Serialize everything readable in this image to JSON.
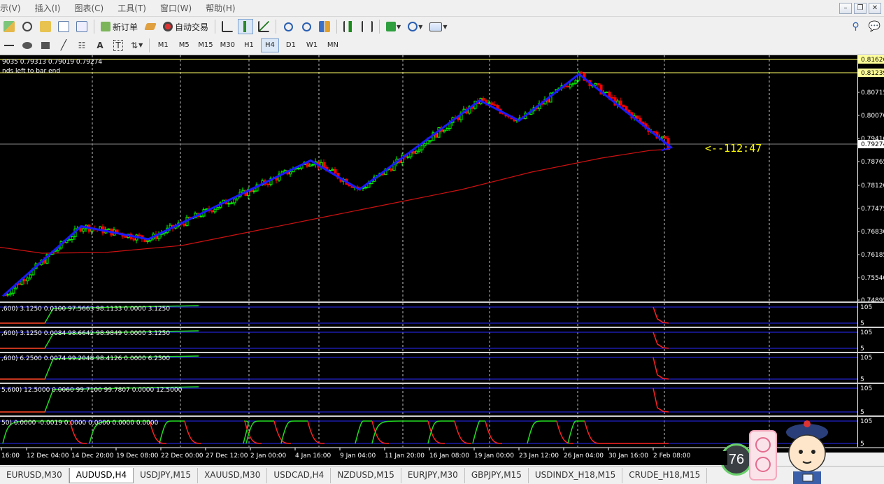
{
  "menu": {
    "items": [
      "示(V)",
      "插入(I)",
      "图表(C)",
      "工具(T)",
      "窗口(W)",
      "帮助(H)"
    ]
  },
  "toolbar": {
    "new_order_label": "新订单",
    "auto_trade_label": "自动交易"
  },
  "timeframes": [
    "M1",
    "M5",
    "M15",
    "M30",
    "H1",
    "H4",
    "D1",
    "W1",
    "MN"
  ],
  "active_timeframe": "H4",
  "chart": {
    "ohlc_text": "9035 0.79313 0.79019 0.79274",
    "seconds_text": "nds left to bar end",
    "timer_text": "<--112:47",
    "price_labels": [
      "0.81626",
      "0.81239",
      "0.80715",
      "0.80070",
      "0.79410",
      "0.79274",
      "0.78765",
      "0.78120",
      "0.77475",
      "0.76830",
      "0.76185",
      "0.75540",
      "0.74895"
    ],
    "highlight_prices": {
      "line_high": "0.81626",
      "line_mid": "0.81239",
      "current": "0.79274"
    },
    "date_labels": [
      "16:00",
      "12 Dec 04:00",
      "14 Dec 20:00",
      "19 Dec 08:00",
      "22 Dec 00:00",
      "27 Dec 12:00",
      "2 Jan 00:00",
      "4 Jan 16:00",
      "9 Jan 04:00",
      "11 Jan 20:00",
      "16 Jan 08:00",
      "19 Jan 00:00",
      "23 Jan 12:00",
      "26 Jan 04:00",
      "30 Jan 16:00",
      "2 Feb 08:00"
    ]
  },
  "indicators": [
    {
      "text": ",600) 3.1250 0.0100 97.5663 98.1133 0.0000 3.1250",
      "levels": [
        "105",
        "5"
      ]
    },
    {
      "text": ",600) 3.1250 0.0084 98.6642 98.9849 0.0000 3.1250",
      "levels": [
        "105",
        "5"
      ]
    },
    {
      "text": ",600) 6.2500 0.0074 99.2048 98.4126 0.0000 6.2500",
      "levels": [
        "105",
        "5"
      ]
    },
    {
      "text": "5,600) 12.5000 0.0060 99.7100 99.7807 0.0000 12.5000",
      "levels": [
        "105",
        "5"
      ]
    },
    {
      "text": "50) 0.0000 -0.0019 0.0000 0.0000 0.0000 0.0000",
      "levels": [
        "105",
        "5"
      ]
    }
  ],
  "tabs": [
    "EURUSD,M30",
    "AUDUSD,H4",
    "USDJPY,M15",
    "XAUUSD,M30",
    "USDCAD,H4",
    "NZDUSD,M15",
    "EURJPY,M30",
    "GBPJPY,M15",
    "USDINDX_H18,M15",
    "CRUDE_H18,M15"
  ],
  "active_tab": "AUDUSD,H4",
  "widget": {
    "badge_number": "76"
  },
  "colors": {
    "chart_bg": "#000000",
    "candle_up": "#00ff00",
    "candle_down": "#ff0000",
    "zigzag": "#1a1aff",
    "moving_average": "#cc1111",
    "timer": "#ffff00",
    "indicator_green": "#22dd22",
    "indicator_red": "#ff2222",
    "level_line": "#2a2aff"
  }
}
